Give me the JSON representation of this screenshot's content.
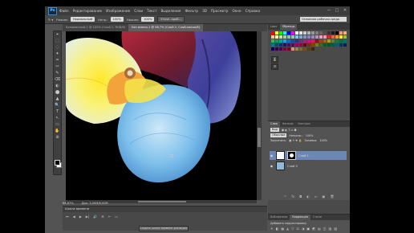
{
  "app": {
    "logo": "Ps",
    "menu": [
      "Файл",
      "Редактирование",
      "Изображение",
      "Слои",
      "Текст",
      "Выделение",
      "Фильтр",
      "3D",
      "Просмотр",
      "Окно",
      "Справка"
    ],
    "window_controls": [
      "—",
      "□",
      "✕"
    ]
  },
  "options_bar": {
    "feather_label": "Режим:",
    "mode_value": "Нормальный",
    "opacity_label": "Непр.:",
    "opacity_value": "100%",
    "flow_label": "Нажим:",
    "flow_value": "100%",
    "refine_button": "Уточн. край...",
    "workspace": "Основная рабочая среда"
  },
  "tools": [
    "⌖",
    "⬚",
    "◌",
    "✦",
    "⌗",
    "✂",
    "✎",
    "⌫",
    "◐",
    "⬤",
    "▲",
    "🔍",
    "T",
    "↖",
    "▭",
    "✋",
    "⊕"
  ],
  "doc_tabs": [
    {
      "label": "Безымянный-1 @ 100% (Слой 1, RGB/8)",
      "active": false
    },
    {
      "label": "Без имени-1 @ 66,7% (Слой 1, Слой-маска/8)",
      "active": true
    }
  ],
  "status": {
    "zoom": "66,67%",
    "doc_size": "Док: 3,00M/6,00M"
  },
  "timeline": {
    "title": "Шкала времени",
    "controls": [
      "⏮",
      "◀",
      "▶",
      "▶|",
      "🔊",
      "⚙",
      "✂",
      "▭"
    ],
    "create_button": "Создать шкалу времени для видео"
  },
  "right_panels": {
    "top_tabs": [
      "Цвет",
      "Образцы"
    ],
    "swatch_colors": [
      "#ff0000",
      "#ffff00",
      "#00ff00",
      "#00ffff",
      "#0000ff",
      "#ff00ff",
      "#ffffff",
      "#e6e6e6",
      "#cccccc",
      "#b3b3b3",
      "#999999",
      "#808080",
      "#666666",
      "#4d4d4d",
      "#333333",
      "#1a1a1a",
      "#000000",
      "#f7977a",
      "#f9ad81",
      "#fdc68a",
      "#fff79a",
      "#c4df9b",
      "#a2d39c",
      "#82ca9d",
      "#7bcdc8",
      "#6ecff6",
      "#7ea7d8",
      "#8493ca",
      "#8882be",
      "#a187be",
      "#bc8dbf",
      "#f49ac2",
      "#f6989d",
      "#ed1c24",
      "#f26522",
      "#f7941d",
      "#fff200",
      "#8dc63f",
      "#39b54a",
      "#00a651",
      "#00a99d",
      "#00aeef",
      "#0072bc",
      "#0054a6",
      "#2e3192",
      "#662d91",
      "#92278f",
      "#ec008c",
      "#ed145b",
      "#9e0b0f",
      "#a0410d",
      "#a36209",
      "#aba000",
      "#598527",
      "#1a7b30",
      "#007236",
      "#00746b",
      "#0076a3",
      "#004b80",
      "#003471",
      "#1b1464",
      "#440e62",
      "#630460",
      "#9e005d",
      "#9e0039",
      "#790000",
      "#7b2e00",
      "#7d4900",
      "#827b00",
      "#406618",
      "#005e20",
      "#005826",
      "#005952",
      "#005b7f",
      "#003663",
      "#002157",
      "#0d004c",
      "#32004b",
      "#4b0049",
      "#7b0046",
      "#7a0026",
      "#c69c6d",
      "#a67c52",
      "#8c6239",
      "#754c24",
      "#603913",
      "#3c2415"
    ],
    "layer_tabs": [
      "Слои",
      "Каналы",
      "Контуры"
    ],
    "kind_filter": "Вид",
    "blend_mode": "Обычные",
    "opacity_label": "Непрозр.:",
    "opacity_value": "100%",
    "lock_label": "Закрепить:",
    "fill_label": "Заливка:",
    "fill_value": "100%",
    "layers": [
      {
        "name": "Слой 1",
        "has_mask": true,
        "selected": true
      },
      {
        "name": "Слой 0",
        "has_mask": false,
        "selected": false
      }
    ],
    "layer_footer": [
      "ᵒᵒ",
      "fx",
      "◘",
      "◐",
      "▭",
      "▣",
      "🗑"
    ],
    "adjust_tabs": [
      "Библиотеки",
      "Коррекция",
      "Стили"
    ],
    "adjust_title": "Добавить корректировку",
    "adjust_icons": [
      "☀",
      "◧",
      "▦",
      "◭",
      "▽",
      "⚖",
      "◑",
      "▣",
      "◩",
      "▤",
      "◫",
      "▥",
      "▧"
    ]
  }
}
